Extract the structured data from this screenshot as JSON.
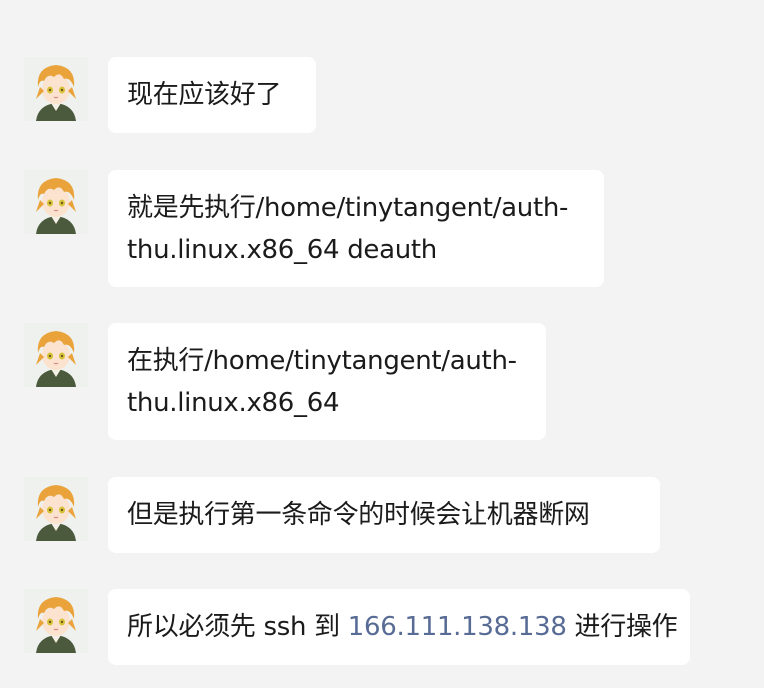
{
  "chat": {
    "messages": [
      {
        "lines": [
          "现在应该好了"
        ]
      },
      {
        "lines": [
          "就是先执行/home/tinytangent/auth-",
          "thu.linux.x86_64 deauth"
        ]
      },
      {
        "lines": [
          "在执行/home/tinytangent/auth-",
          "thu.linux.x86_64"
        ]
      },
      {
        "lines": [
          "但是执行第一条命令的时候会让机器断网"
        ]
      },
      {
        "before": "所以必须先 ssh 到 ",
        "link": "166.111.138.138",
        "after": " 进行操作"
      }
    ]
  },
  "colors": {
    "background": "#f3f3f3",
    "bubble": "#ffffff",
    "text": "#1b1b1b",
    "link": "#576b95",
    "avatar_hair": "#e9a33a",
    "avatar_eyes": "#d8c33a",
    "avatar_coat": "#4b5a3c"
  },
  "icons": {
    "avatar": "anime-avatar-icon"
  }
}
